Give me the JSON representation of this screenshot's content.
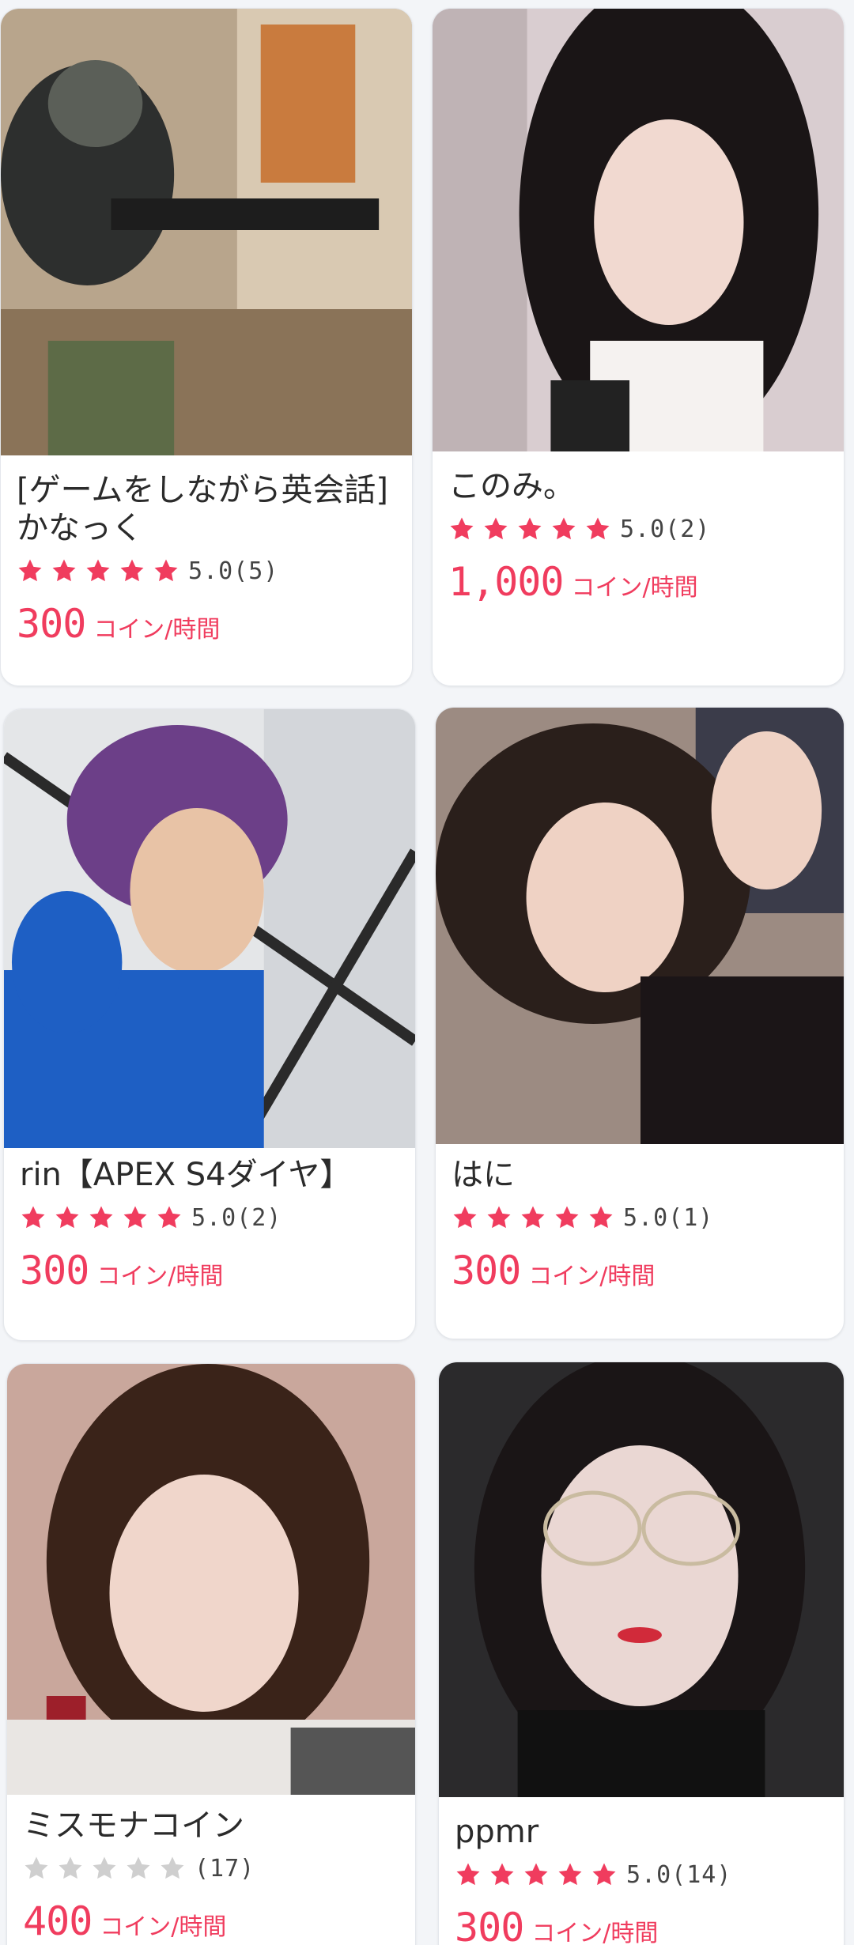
{
  "colors": {
    "accent": "#f03c5e",
    "star_filled": "#f03c5e",
    "star_empty": "#cfcfcf"
  },
  "cards": [
    {
      "name": "[ゲームをしながら英会話] かなっく",
      "stars": 5,
      "score": "5.0(5)",
      "price": "300",
      "unit": "コイン/時間"
    },
    {
      "name": "このみ。",
      "stars": 5,
      "score": "5.0(2)",
      "price": "1,000",
      "unit": "コイン/時間"
    },
    {
      "name": "rin【APEX S4ダイヤ】",
      "stars": 5,
      "score": "5.0(2)",
      "price": "300",
      "unit": "コイン/時間"
    },
    {
      "name": "はに",
      "stars": 5,
      "score": "5.0(1)",
      "price": "300",
      "unit": "コイン/時間"
    },
    {
      "name": "ミスモナコイン",
      "stars": 0,
      "score": "(17)",
      "price": "400",
      "unit": "コイン/時間"
    },
    {
      "name": "ppmr",
      "stars": 5,
      "score": "5.0(14)",
      "price": "300",
      "unit": "コイン/時間"
    }
  ]
}
